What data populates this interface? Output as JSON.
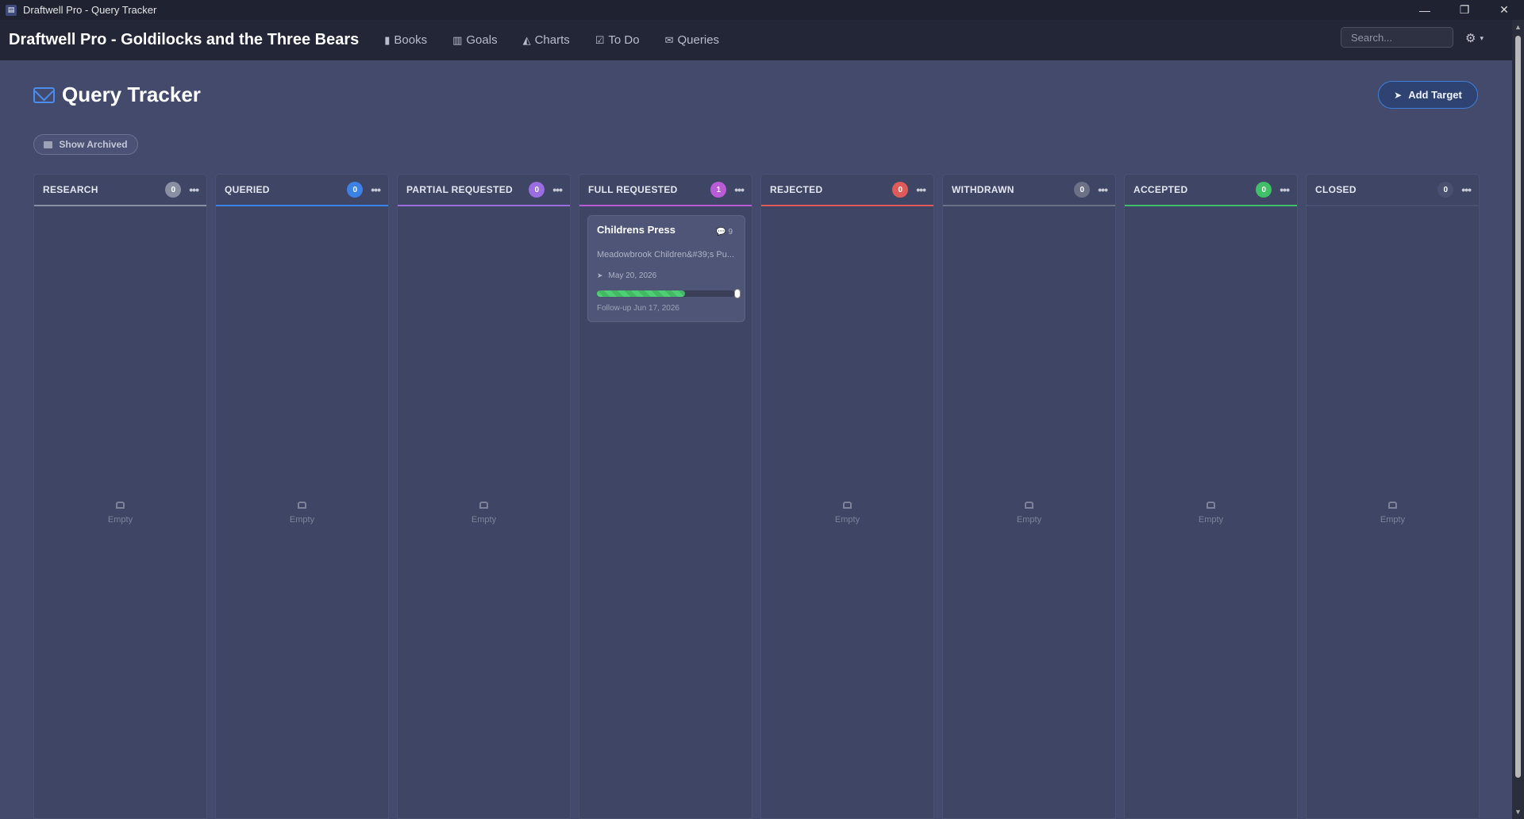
{
  "window": {
    "title": "Draftwell Pro - Query Tracker",
    "controls": {
      "minimize": "—",
      "restore": "❐",
      "close": "✕"
    }
  },
  "nav": {
    "brand": "Draftwell Pro - Goldilocks and the Three Bears",
    "links": [
      {
        "label": "Books",
        "icon": "book-icon",
        "glyph": "📕"
      },
      {
        "label": "Goals",
        "icon": "bar-chart-icon",
        "glyph": "▥"
      },
      {
        "label": "Charts",
        "icon": "area-chart-icon",
        "glyph": "◭"
      },
      {
        "label": "To Do",
        "icon": "check-square-icon",
        "glyph": "☑"
      },
      {
        "label": "Queries",
        "icon": "envelope-icon",
        "glyph": "✉"
      }
    ],
    "search_placeholder": "Search...",
    "settings_glyph": "⚙",
    "caret": "▾"
  },
  "page": {
    "title": "Query Tracker",
    "add_target_label": "Add Target",
    "show_archived_label": "Show Archived",
    "plane_glyph": "➤"
  },
  "columns": [
    {
      "key": "research",
      "title": "RESEARCH",
      "count": "0",
      "color": "#8a8fa3",
      "empty": "Empty"
    },
    {
      "key": "queried",
      "title": "QUERIED",
      "count": "0",
      "color": "#3b82e6",
      "empty": "Empty"
    },
    {
      "key": "partial-requested",
      "title": "PARTIAL REQUESTED",
      "count": "0",
      "color": "#9b6de0",
      "empty": "Empty"
    },
    {
      "key": "full-requested",
      "title": "FULL REQUESTED",
      "count": "1",
      "color": "#b95bd6",
      "empty": ""
    },
    {
      "key": "rejected",
      "title": "REJECTED",
      "count": "0",
      "color": "#e05a5a",
      "empty": "Empty"
    },
    {
      "key": "withdrawn",
      "title": "WITHDRAWN",
      "count": "0",
      "color": "#6c7186",
      "empty": "Empty"
    },
    {
      "key": "accepted",
      "title": "ACCEPTED",
      "count": "0",
      "color": "#3fbf68",
      "empty": "Empty"
    },
    {
      "key": "closed",
      "title": "CLOSED",
      "count": "0",
      "color": "#4a5070",
      "empty": "Empty"
    }
  ],
  "card": {
    "title": "Childrens Press",
    "comments": "9",
    "publisher": "Meadowbrook Children&#39;s Pu...",
    "sent_date": "May 20, 2026",
    "progress": 0.64,
    "followup": "Follow-up Jun 17, 2026"
  }
}
